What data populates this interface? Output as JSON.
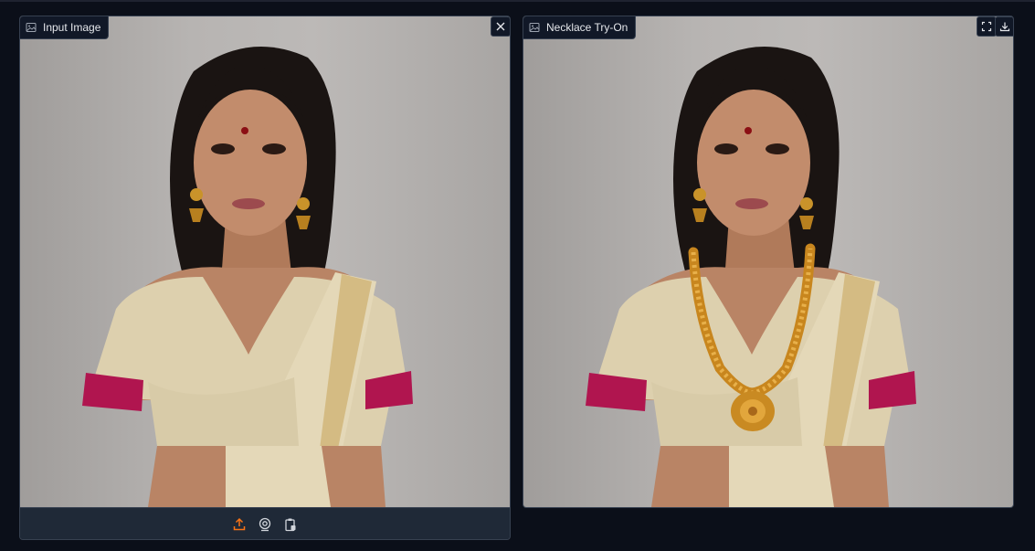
{
  "input_panel": {
    "label": "Input Image",
    "label_icon": "image-icon",
    "close_icon": "close-icon",
    "toolbar": {
      "upload_icon": "upload-icon",
      "webcam_icon": "webcam-icon",
      "clipboard_icon": "clipboard-paste-icon"
    }
  },
  "output_panel": {
    "label": "Necklace Try-On",
    "label_icon": "image-icon",
    "fullscreen_icon": "fullscreen-icon",
    "download_icon": "download-icon"
  },
  "colors": {
    "page_bg": "#0b0f19",
    "panel_border": "#374151",
    "accent_orange": "#f97316",
    "backdrop_gray": "#b5b2b0"
  }
}
